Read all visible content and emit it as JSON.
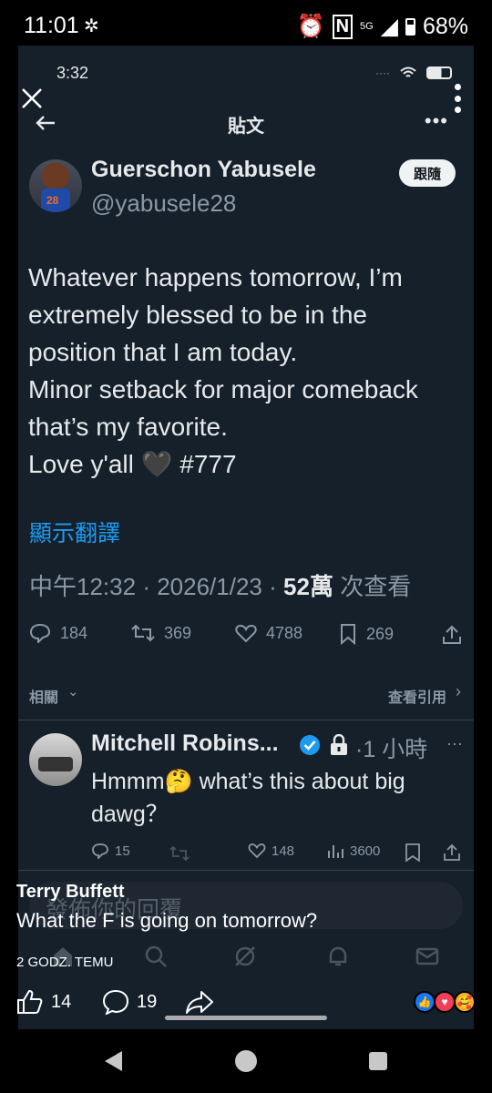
{
  "status_bar": {
    "time": "11:01",
    "network": "5G",
    "battery": "68%"
  },
  "shot": {
    "time": "3:32",
    "nav_title": "貼文",
    "author": {
      "name": "Guerschon Yabusele",
      "handle": "@yabusele28",
      "follow_label": "跟隨",
      "jersey": "28"
    },
    "tweet_text": "Whatever happens tomorrow, I’m\nextremely blessed to be in the\nposition that I am today.\nMinor setback for major comeback\nthat’s my favorite.\nLove y'all 🖤 #777",
    "translate_label": "顯示翻譯",
    "meta": {
      "time": "中午12:32",
      "date": "2026/1/23",
      "views_count": "52萬",
      "views_label": "次查看",
      "sep": "·"
    },
    "stats": {
      "replies": "184",
      "retweets": "369",
      "likes": "4788",
      "bookmarks": "269"
    },
    "related_label": "相關",
    "quotes_label": "查看引用",
    "reply": {
      "name": "Mitchell Robins...",
      "time": "·1 小時",
      "text": "Hmmm🤔 what’s this about big dawg？",
      "stats": {
        "replies": "15",
        "likes": "148",
        "views": "3600"
      }
    },
    "compose_placeholder": "發佈你的回覆"
  },
  "overlay": {
    "commenter": "Terry Buffett",
    "comment": "What the F is going on tomorrow?",
    "meta": "2 GODZ. TEMU",
    "likes": "14",
    "comments": "19"
  },
  "colors": {
    "bg": "#15202b",
    "accent": "#1d9bf0",
    "muted": "#8b98a5"
  }
}
